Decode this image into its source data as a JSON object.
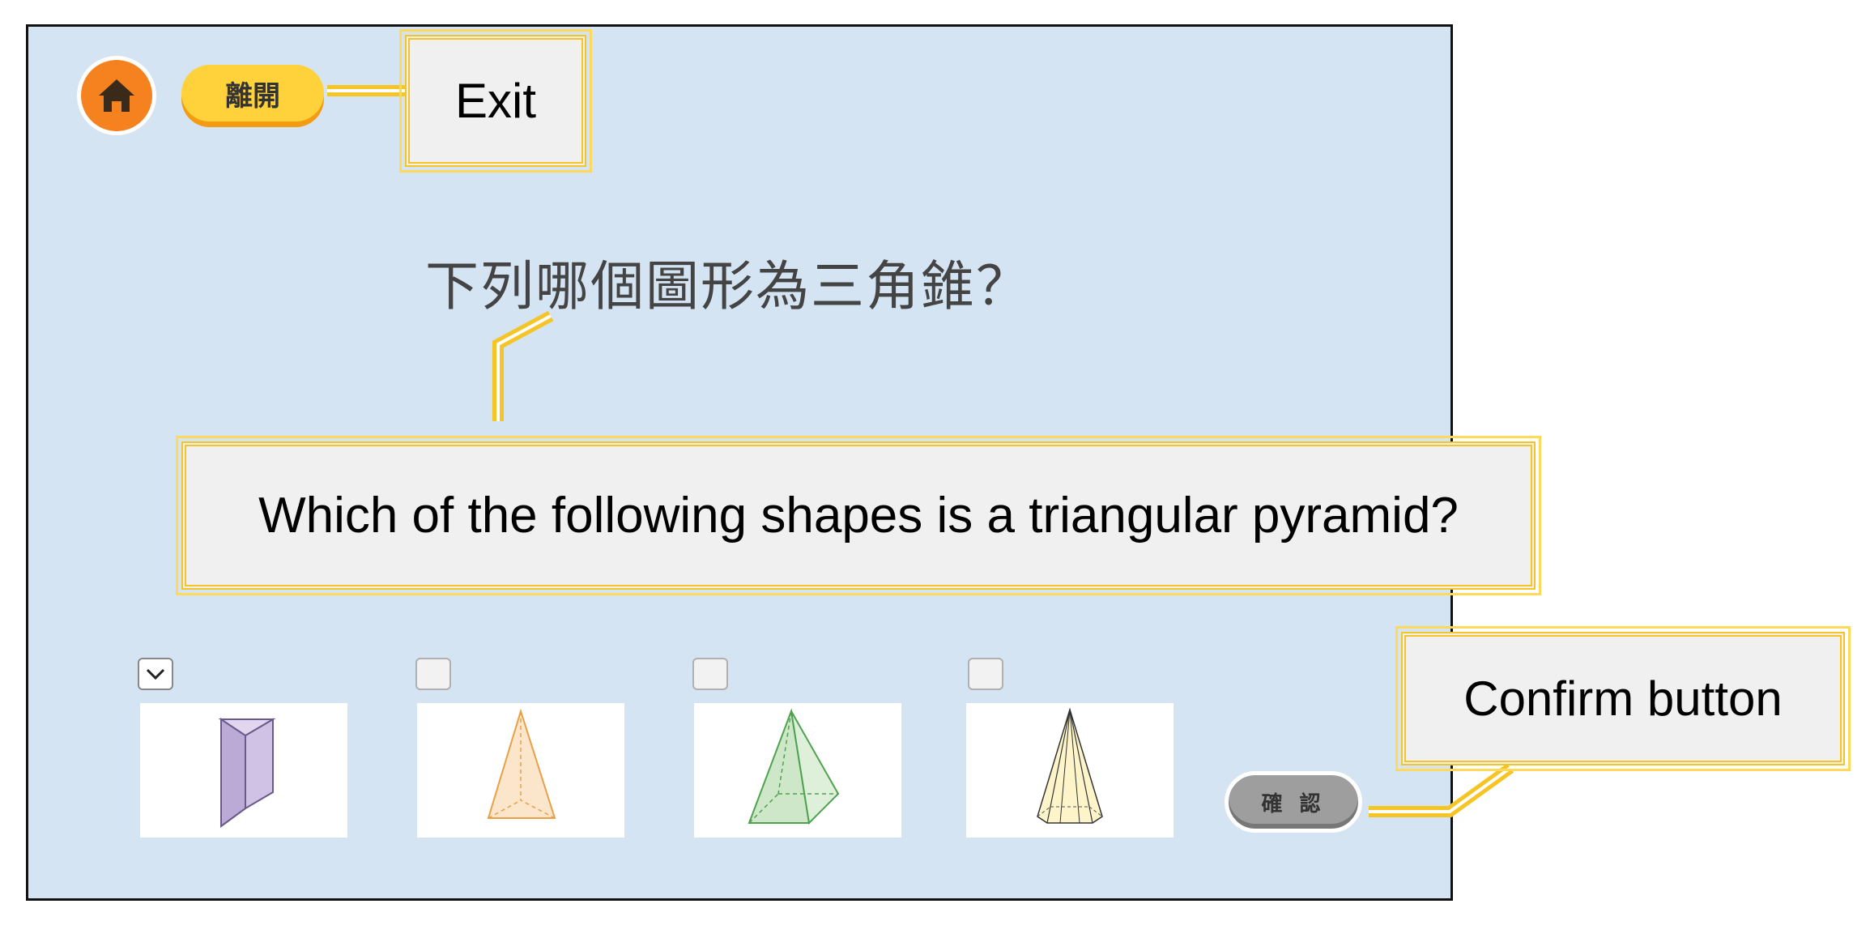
{
  "app": {
    "exit_label": "離開",
    "question": "下列哪個圖形為三角錐？",
    "confirm_label": "確 認"
  },
  "options": [
    {
      "shape": "triangular-prism",
      "checked": true
    },
    {
      "shape": "cone",
      "checked": false
    },
    {
      "shape": "square-pyramid",
      "checked": false
    },
    {
      "shape": "hexagonal-pyramid",
      "checked": false
    }
  ],
  "annotations": {
    "exit": "Exit",
    "question_translation": "Which of the following shapes is a triangular pyramid?",
    "confirm": "Confirm button"
  },
  "colors": {
    "screen_bg": "#d4e4f3",
    "accent_orange": "#f5821f",
    "accent_yellow": "#ffd23c",
    "callout_border": "#f4c524"
  }
}
